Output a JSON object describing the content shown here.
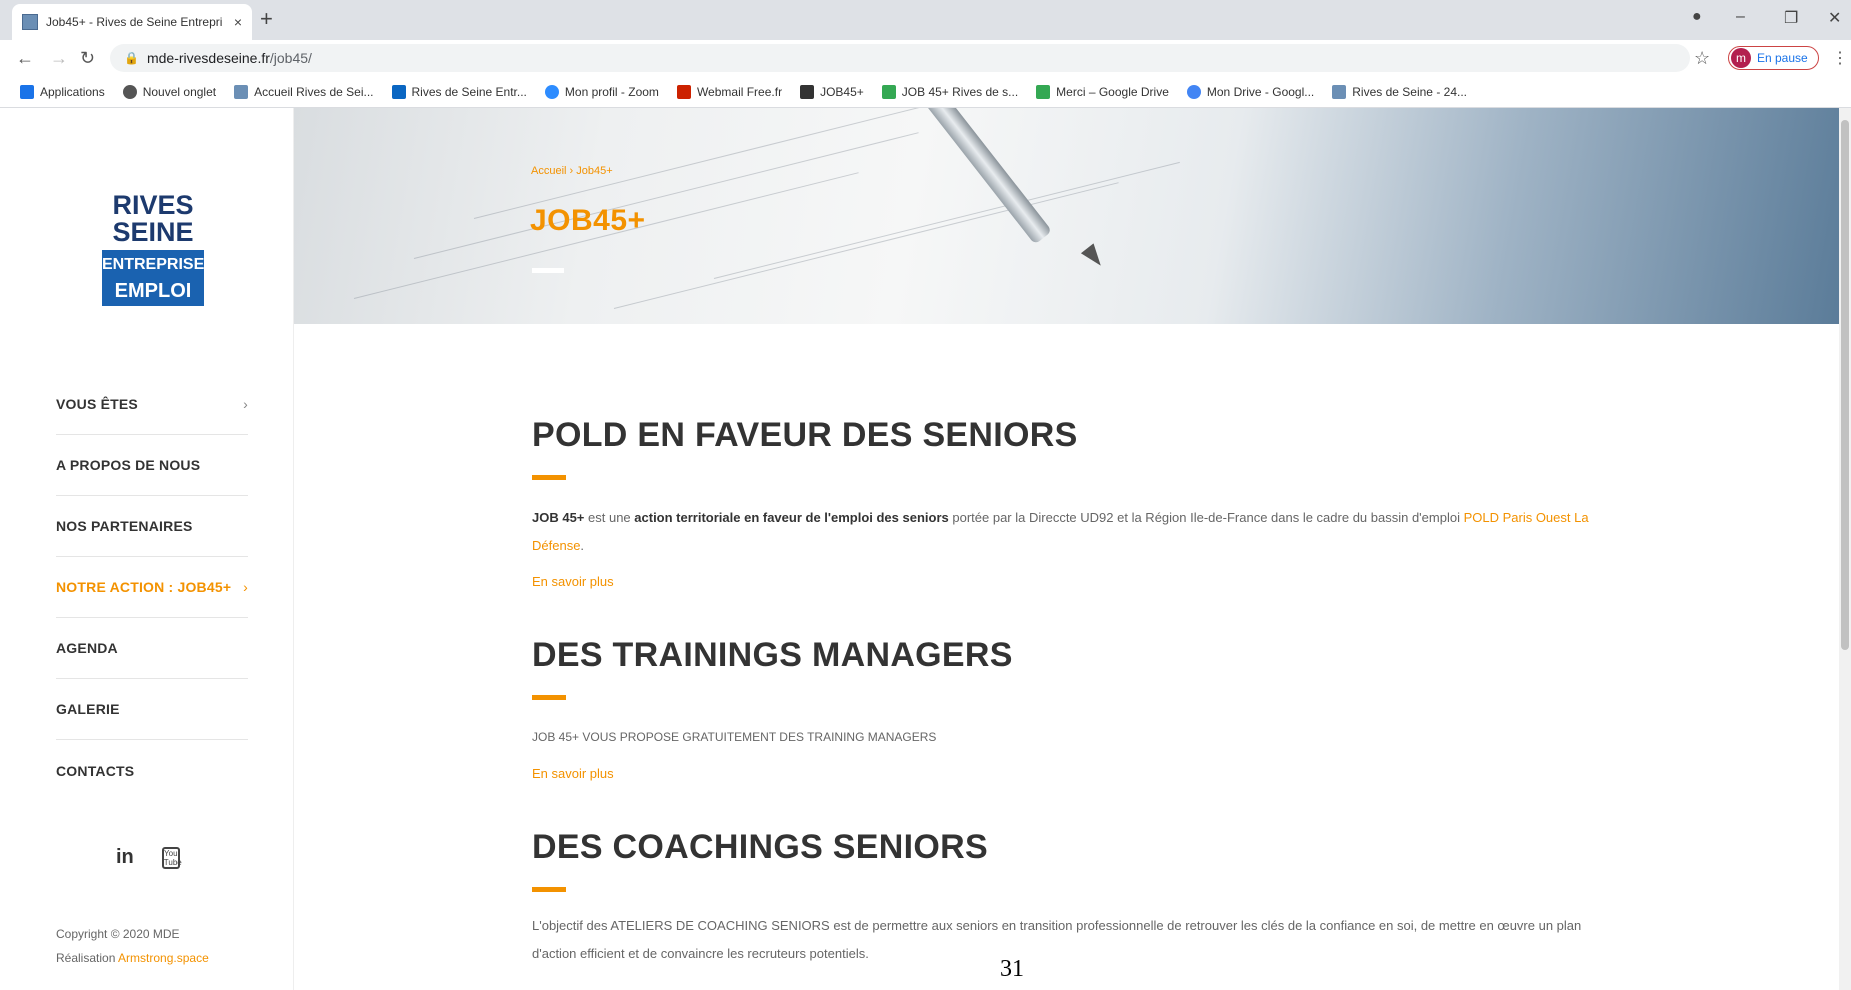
{
  "browser": {
    "tab_title": "Job45+ - Rives de Seine Entrepri",
    "tab_close": "×",
    "new_tab": "+",
    "url_host": "mde-rivesdeseine.fr",
    "url_path": "/job45/",
    "profile_initial": "m",
    "profile_label": "En pause",
    "bookmarks": [
      {
        "label": "Applications",
        "color": "#1a73e8"
      },
      {
        "label": "Nouvel onglet",
        "color": "#555555"
      },
      {
        "label": "Accueil Rives de Sei...",
        "color": "#6b8fb5"
      },
      {
        "label": "Rives de Seine Entr...",
        "color": "#0a66c2"
      },
      {
        "label": "Mon profil - Zoom",
        "color": "#2d8cff"
      },
      {
        "label": "Webmail Free.fr",
        "color": "#cc2200"
      },
      {
        "label": "JOB45+",
        "color": "#333333"
      },
      {
        "label": "JOB 45+ Rives de s...",
        "color": "#34a853"
      },
      {
        "label": "Merci – Google Drive",
        "color": "#34a853"
      },
      {
        "label": "Mon Drive - Googl...",
        "color": "#4285f4"
      },
      {
        "label": "Rives de Seine - 24...",
        "color": "#6b8fb5"
      }
    ]
  },
  "logo": {
    "line1": "RIVES",
    "line2": "SEINE",
    "line3": "ENTREPRISE",
    "line4": "EMPLOI"
  },
  "sidebar": {
    "items": [
      {
        "label": "VOUS ÊTES",
        "chevron": "›"
      },
      {
        "label": "A PROPOS DE NOUS"
      },
      {
        "label": "NOS PARTENAIRES"
      },
      {
        "label": "NOTRE ACTION : JOB45+",
        "chevron": "›"
      },
      {
        "label": "AGENDA"
      },
      {
        "label": "GALERIE"
      },
      {
        "label": "CONTACTS"
      }
    ],
    "social_linkedin": "in",
    "social_youtube": "You Tube",
    "copyright": "Copyright © 2020 MDE",
    "realisation": "Réalisation",
    "realisation_link": "Armstrong.space"
  },
  "hero": {
    "breadcrumb_home": "Accueil",
    "breadcrumb_sep": "›",
    "breadcrumb_current": "Job45+",
    "title": "JOB45+"
  },
  "sections": [
    {
      "title": "POLD EN FAVEUR DES SENIORS",
      "p_strong1": "JOB 45+",
      "p_text1": " est une ",
      "p_strong2": "action territoriale en faveur de l'emploi des seniors",
      "p_text2": " portée par la Direccte UD92 et la Région Ile-de-France dans le cadre du bassin d'emploi ",
      "p_link": "POLD Paris Ouest La Défense",
      "p_text3": ".",
      "more": "En savoir plus"
    },
    {
      "title": "DES TRAININGS MANAGERS",
      "text": "JOB 45+ VOUS PROPOSE GRATUITEMENT DES TRAINING MANAGERS",
      "more": "En savoir plus"
    },
    {
      "title": "DES COACHINGS SENIORS",
      "text": "L'objectif des ATELIERS DE COACHING SENIORS est de permettre aux seniors en transition professionnelle de retrouver les clés de la confiance en soi, de mettre en œuvre un plan d'action efficient et de convaincre les recruteurs potentiels."
    }
  ],
  "page_number": "31",
  "colors": {
    "accent": "#f39200",
    "brand_blue": "#1a62b0",
    "text": "#333333"
  }
}
